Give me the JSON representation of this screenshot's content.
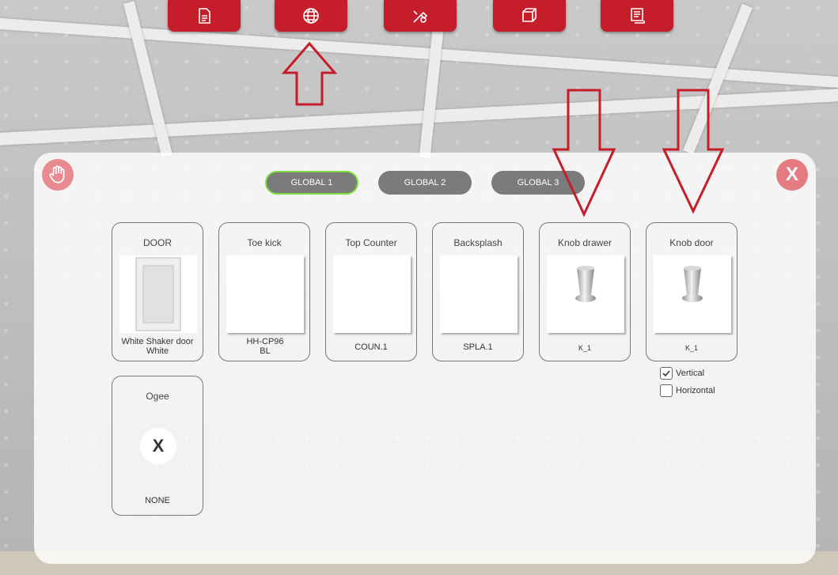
{
  "toolbar": {
    "buttons": [
      {
        "icon": "document-icon"
      },
      {
        "icon": "globe-icon"
      },
      {
        "icon": "tools-icon"
      },
      {
        "icon": "cube-icon"
      },
      {
        "icon": "report-icon"
      }
    ]
  },
  "panel": {
    "close_label": "X",
    "tabs": [
      {
        "label": "GLOBAL 1",
        "active": true
      },
      {
        "label": "GLOBAL 2",
        "active": false
      },
      {
        "label": "GLOBAL 3",
        "active": false
      }
    ],
    "cards": [
      {
        "title": "DOOR",
        "value": "White Shaker door White"
      },
      {
        "title": "Toe kick",
        "value": "HH-CP96 BL"
      },
      {
        "title": "Top Counter",
        "value": "COUN.1"
      },
      {
        "title": "Backsplash",
        "value": "SPLA.1"
      },
      {
        "title": "Knob drawer",
        "value": "K_1"
      },
      {
        "title": "Knob door",
        "value": "K_1"
      }
    ],
    "molding": {
      "title": "Ogee",
      "remove_label": "X",
      "value": "NONE"
    },
    "orientation": [
      {
        "label": "Vertical",
        "checked": true
      },
      {
        "label": "Horizontal",
        "checked": false
      }
    ]
  },
  "colors": {
    "accent": "#c51d2a",
    "tab": "#7b7b7b",
    "active_outline": "#7ee03b"
  }
}
